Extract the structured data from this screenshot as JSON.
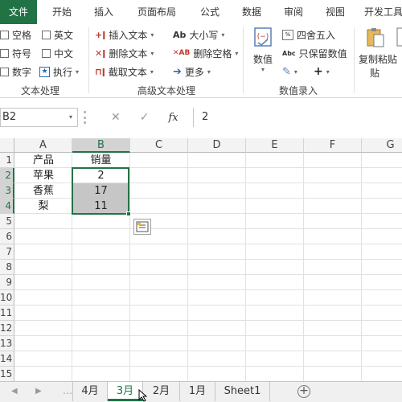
{
  "ribbon_tabs": [
    "文件",
    "开始",
    "插入",
    "页面布局",
    "公式",
    "数据",
    "审阅",
    "视图",
    "开发工具"
  ],
  "text_processing": {
    "checkboxes": [
      "空格",
      "英文",
      "符号",
      "中文",
      "数字"
    ],
    "execute_label": "执行",
    "group_label": "文本处理"
  },
  "advanced_text": {
    "insert_text": "插入文本",
    "delete_text": "删除文本",
    "extract_text": "截取文本",
    "case": "大小写",
    "delete_spaces": "删除空格",
    "more": "更多",
    "group_label": "高级文本处理"
  },
  "numeric_entry": {
    "numeric": "数值",
    "round": "四舍五入",
    "keep_values": "只保留数值",
    "group_label": "数值录入"
  },
  "clipboard": {
    "copy_paste": "复制粘贴",
    "copy_paste_line2": "贴"
  },
  "formula_bar": {
    "name_box": "B2",
    "fx": "fx",
    "value": "2"
  },
  "columns": [
    "A",
    "B",
    "C",
    "D",
    "E",
    "F",
    "G"
  ],
  "selected_column": "B",
  "rows": [
    "1",
    "2",
    "3",
    "4",
    "5",
    "6",
    "7",
    "8",
    "9",
    "10",
    "11",
    "12",
    "13",
    "14",
    "15"
  ],
  "selected_rows": [
    "2",
    "3",
    "4"
  ],
  "cells": {
    "A1": "产品",
    "B1": "销量",
    "A2": "苹果",
    "B2": "2",
    "A3": "香蕉",
    "B3": "17",
    "A4": "梨",
    "B4": "11"
  },
  "sheet_tabs": [
    "4月",
    "3月",
    "2月",
    "1月",
    "Sheet1"
  ],
  "active_sheet": "3月",
  "colors": {
    "excel_green": "#217346",
    "header_gray": "#f3f3f3",
    "selection_shade": "#c6c6c6"
  }
}
